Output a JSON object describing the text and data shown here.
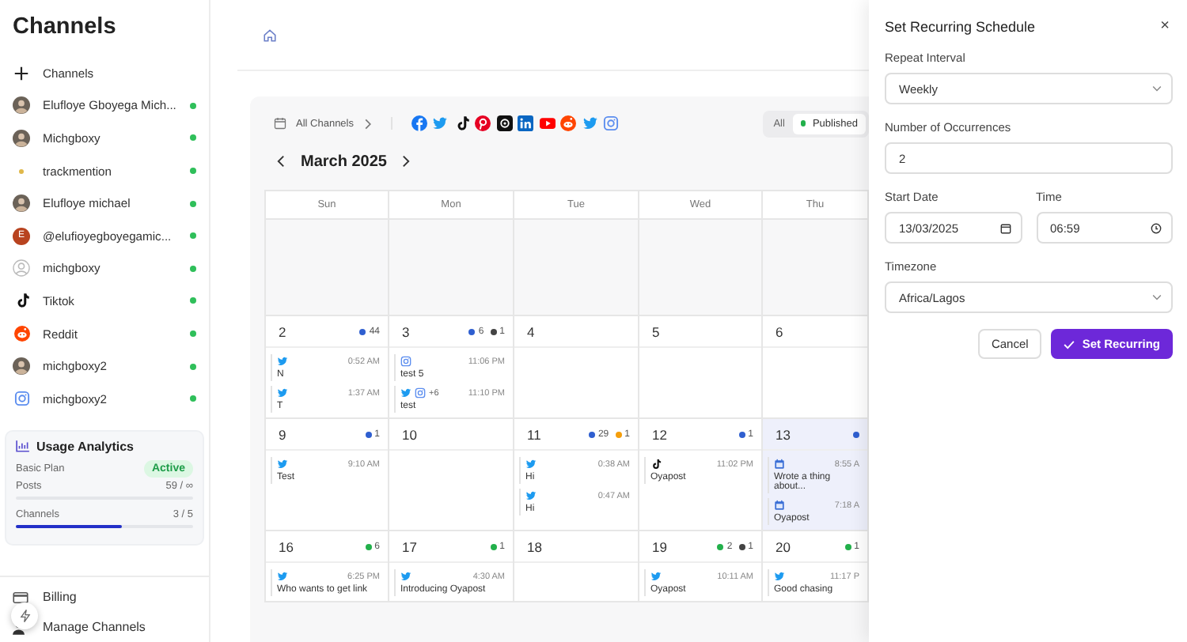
{
  "sidebar": {
    "title": "Channels",
    "add_label": "Channels",
    "channels": [
      {
        "name": "Elufloye Gboyega Mich...",
        "kind": "photo",
        "connected": true
      },
      {
        "name": "Michgboxy",
        "kind": "photo",
        "connected": true
      },
      {
        "name": "trackmention",
        "kind": "dot",
        "connected": true
      },
      {
        "name": "Elufloye michael",
        "kind": "photo",
        "connected": true
      },
      {
        "name": "@elufioyegboyegamic...",
        "kind": "letter",
        "letter": "E",
        "connected": true
      },
      {
        "name": "michgboxy",
        "kind": "placeholder",
        "connected": true
      },
      {
        "name": "Tiktok",
        "kind": "tiktok",
        "connected": true
      },
      {
        "name": "Reddit",
        "kind": "reddit",
        "connected": true
      },
      {
        "name": "michgboxy2",
        "kind": "photo",
        "connected": true
      },
      {
        "name": "michgboxy2",
        "kind": "instagram",
        "connected": true
      }
    ],
    "usage": {
      "title": "Usage Analytics",
      "plan": "Basic Plan",
      "plan_status": "Active",
      "posts_label": "Posts",
      "posts_value": "59 / ∞",
      "channels_label": "Channels",
      "channels_value": "3 / 5",
      "channels_bar": {
        "level": 0.6
      }
    },
    "footer": [
      {
        "label": "Billing",
        "kind": "billing"
      },
      {
        "label": "Manage Channels",
        "kind": "manage"
      }
    ]
  },
  "toolbar": {
    "channel_filter": "All Channels",
    "platforms": [
      {
        "kind": "facebook"
      },
      {
        "kind": "twitter"
      },
      {
        "kind": "tiktok"
      },
      {
        "kind": "pinterest"
      },
      {
        "kind": "threads"
      },
      {
        "kind": "linkedin"
      },
      {
        "kind": "youtube"
      },
      {
        "kind": "reddit"
      },
      {
        "kind": "twitter"
      },
      {
        "kind": "instagram"
      }
    ],
    "filters": [
      {
        "label": "All",
        "selected": false
      },
      {
        "label": "Published",
        "selected": true
      }
    ]
  },
  "calendar": {
    "month": "March 2025",
    "weekdays": [
      "Sun",
      "Mon",
      "Tue",
      "Wed",
      "Thu"
    ],
    "weeks": [
      [
        {
          "kind": "blank"
        },
        {
          "kind": "blank"
        },
        {
          "kind": "blank"
        },
        {
          "kind": "blank"
        },
        {
          "kind": "blank"
        }
      ],
      [
        {
          "day": "2",
          "selected": false,
          "counts": [
            {
              "color": "#2f5fd0",
              "count": "44"
            }
          ],
          "posts": [
            {
              "platforms": [
                {
                  "kind": "twitter"
                }
              ],
              "time": "0:52 AM",
              "text": "N"
            },
            {
              "platforms": [
                {
                  "kind": "twitter"
                }
              ],
              "time": "1:37 AM",
              "text": "T"
            }
          ]
        },
        {
          "day": "3",
          "selected": false,
          "counts": [
            {
              "color": "#2f5fd0",
              "count": "6"
            },
            {
              "color": "#444444",
              "count": "1"
            }
          ],
          "posts": [
            {
              "platforms": [
                {
                  "kind": "instagram"
                }
              ],
              "time": "11:06 PM",
              "text": "test 5"
            },
            {
              "platforms": [
                {
                  "kind": "twitter"
                },
                {
                  "kind": "instagram"
                }
              ],
              "extra": "+6",
              "time": "11:10 PM",
              "text": "test"
            }
          ]
        },
        {
          "day": "4",
          "selected": false
        },
        {
          "day": "5",
          "selected": false
        },
        {
          "day": "6",
          "selected": false
        }
      ],
      [
        {
          "day": "9",
          "selected": false,
          "counts": [
            {
              "color": "#2f5fd0",
              "count": "1"
            }
          ],
          "posts": [
            {
              "platforms": [
                {
                  "kind": "twitter"
                }
              ],
              "time": "9:10 AM",
              "text": "Test"
            }
          ]
        },
        {
          "day": "10",
          "selected": false
        },
        {
          "day": "11",
          "selected": false,
          "counts": [
            {
              "color": "#2f5fd0",
              "count": "29"
            },
            {
              "color": "#f59e0b",
              "count": "1"
            }
          ],
          "posts": [
            {
              "platforms": [
                {
                  "kind": "twitter"
                }
              ],
              "time": "0:38 AM",
              "text": "Hi"
            },
            {
              "platforms": [
                {
                  "kind": "twitter"
                }
              ],
              "time": "0:47 AM",
              "text": "Hi"
            }
          ]
        },
        {
          "day": "12",
          "selected": false,
          "counts": [
            {
              "color": "#2f5fd0",
              "count": "1"
            }
          ],
          "posts": [
            {
              "platforms": [
                {
                  "kind": "tiktok"
                }
              ],
              "time": "11:02 PM",
              "text": "Oyapost"
            }
          ]
        },
        {
          "day": "13",
          "selected": true,
          "counts": [
            {
              "color": "#2f5fd0"
            }
          ],
          "posts": [
            {
              "platforms": [
                {
                  "kind": "scheduled"
                }
              ],
              "time": "8:55 A",
              "text": "Wrote a thing about..."
            },
            {
              "platforms": [
                {
                  "kind": "scheduled"
                }
              ],
              "time": "7:18 A",
              "text": "Oyapost"
            }
          ]
        }
      ],
      [
        {
          "day": "16",
          "selected": false,
          "counts": [
            {
              "color": "#22b04b",
              "count": "6"
            }
          ],
          "posts": [
            {
              "platforms": [
                {
                  "kind": "twitter"
                }
              ],
              "time": "6:25 PM",
              "text": "Who wants to get link"
            }
          ]
        },
        {
          "day": "17",
          "selected": false,
          "counts": [
            {
              "color": "#22b04b",
              "count": "1"
            }
          ],
          "posts": [
            {
              "platforms": [
                {
                  "kind": "twitter"
                }
              ],
              "time": "4:30 AM",
              "text": "Introducing Oyapost"
            }
          ]
        },
        {
          "day": "18",
          "selected": false
        },
        {
          "day": "19",
          "selected": false,
          "counts": [
            {
              "color": "#22b04b",
              "count": "2"
            },
            {
              "color": "#444444",
              "count": "1"
            }
          ],
          "posts": [
            {
              "platforms": [
                {
                  "kind": "twitter"
                }
              ],
              "time": "10:11 AM",
              "text": "Oyapost"
            }
          ]
        },
        {
          "day": "20",
          "selected": false,
          "counts": [
            {
              "color": "#22b04b",
              "count": "1"
            }
          ],
          "posts": [
            {
              "platforms": [
                {
                  "kind": "twitter"
                }
              ],
              "time": "11:17 P",
              "text": "Good chasing"
            }
          ]
        }
      ]
    ]
  },
  "dialog": {
    "title": "Set Recurring Schedule",
    "close": "×",
    "repeat_label": "Repeat Interval",
    "repeat_value": "Weekly",
    "occurrences_label": "Number of Occurrences",
    "occurrences_value": "2",
    "date_label": "Start Date",
    "date_value": "13/03/2025",
    "time_label": "Time",
    "time_value": "06:59",
    "timezone_label": "Timezone",
    "timezone_value": "Africa/Lagos",
    "cancel": "Cancel",
    "confirm": "Set Recurring"
  }
}
